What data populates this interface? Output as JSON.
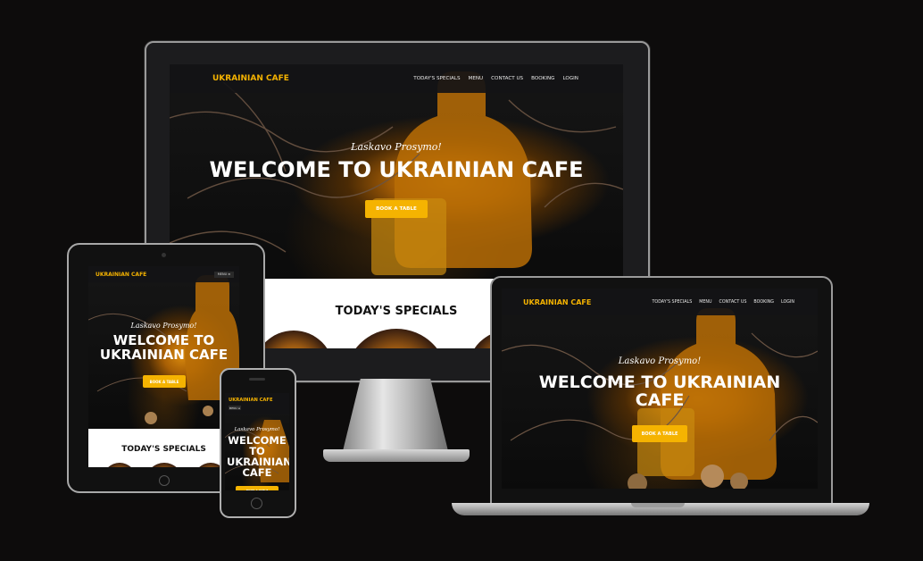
{
  "brand": "UKRAINIAN CAFE",
  "nav_links": [
    "TODAY'S SPECIALS",
    "MENU",
    "CONTACT US",
    "BOOKING",
    "LOGIN"
  ],
  "hero": {
    "tagline": "Laskavo Prosymo!",
    "headline": "WELCOME TO UKRAINIAN CAFE",
    "button": "BOOK A TABLE"
  },
  "specials": {
    "heading": "TODAY'S SPECIALS"
  },
  "mobile_menu_label": "MENU ≡",
  "colors": {
    "accent": "#f5b301",
    "background": "#0d0c0c",
    "nav": "#141416"
  }
}
